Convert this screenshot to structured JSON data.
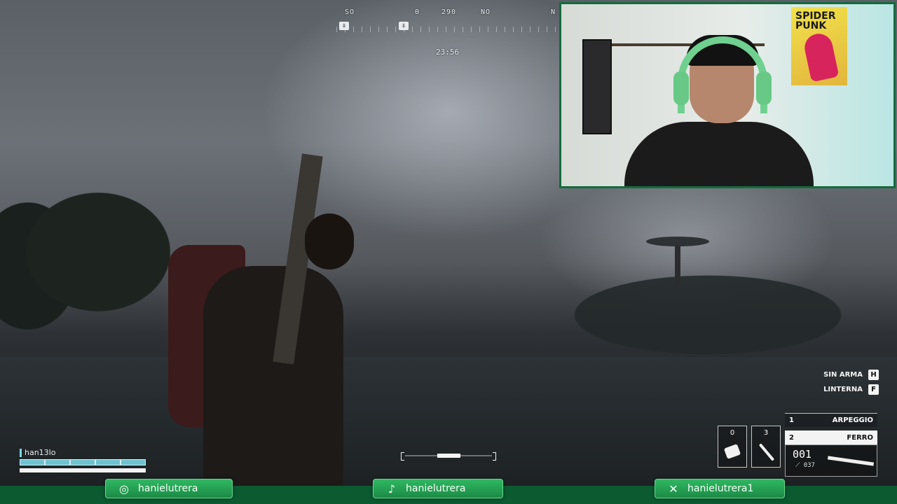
{
  "compass": {
    "labels": [
      "SO",
      "0",
      "290",
      "NO",
      "N"
    ],
    "markers": [
      "download-marker",
      "download-marker"
    ]
  },
  "mission_timer": "23:56",
  "player": {
    "name": "han13lo",
    "health_fraction": 1.0,
    "armor_fraction": 1.0
  },
  "stamina_fraction": 0.27,
  "hints": [
    {
      "label": "SIN ARMA",
      "key": "H"
    },
    {
      "label": "LINTERNA",
      "key": "F"
    }
  ],
  "inventory": {
    "slots": [
      {
        "count": "0",
        "icon": "grenade-icon"
      },
      {
        "count": "3",
        "icon": "hammer-icon"
      }
    ],
    "weapons": [
      {
        "slot": "1",
        "name": "ARPEGGIO",
        "active": false
      },
      {
        "slot": "2",
        "name": "FERRO",
        "active": true
      }
    ],
    "ammo_magazine": "001",
    "ammo_reserve": "037"
  },
  "webcam": {
    "poster_text": "SPIDER PUNK"
  },
  "socials": [
    {
      "platform": "instagram",
      "icon": "instagram-icon",
      "handle": "hanielutrera"
    },
    {
      "platform": "tiktok",
      "icon": "tiktok-icon",
      "handle": "hanielutrera"
    },
    {
      "platform": "x",
      "icon": "x-icon",
      "handle": "hanielutrera1"
    }
  ],
  "colors": {
    "brand_green": "#1c8a46",
    "hud_white": "#f3f3f3",
    "health_cyan": "#6fc2cf"
  }
}
